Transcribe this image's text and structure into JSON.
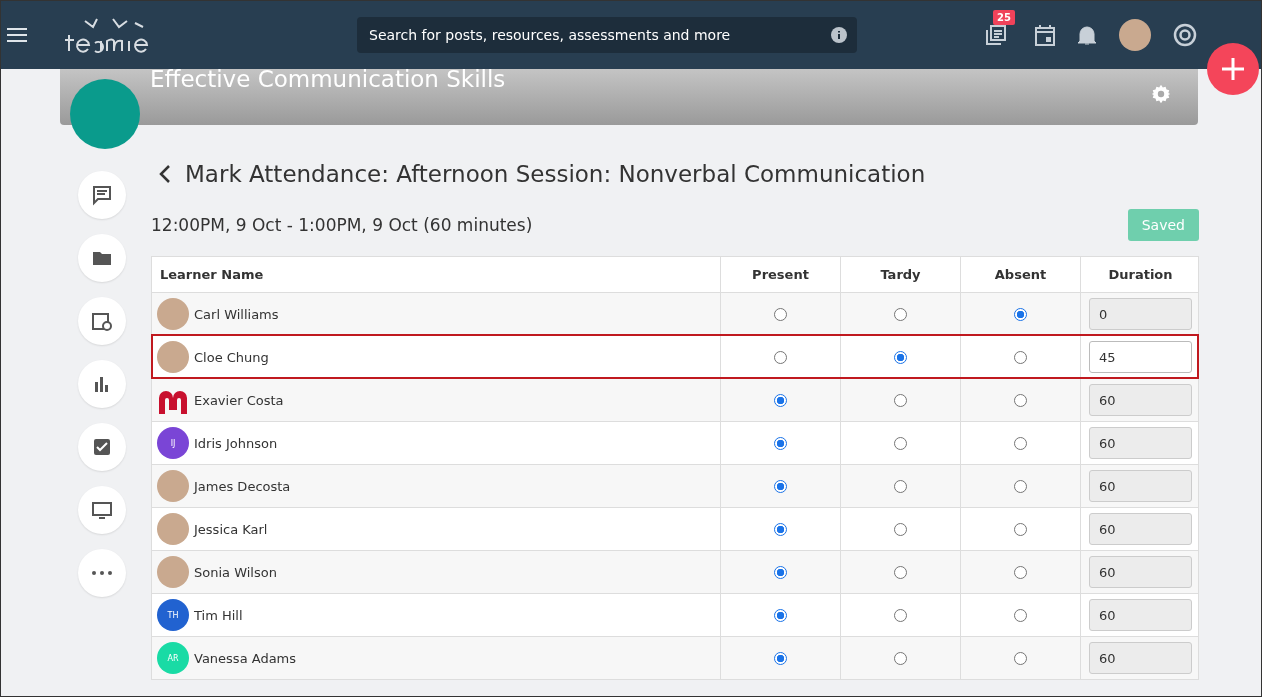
{
  "header": {
    "search": {
      "placeholder": "Search for posts, resources, assessments and more"
    },
    "badge": "25"
  },
  "course": {
    "title": "Effective Communication Skills"
  },
  "sidebar": {
    "items": [
      {
        "kind": "posts"
      },
      {
        "kind": "folder"
      },
      {
        "kind": "schedule"
      },
      {
        "kind": "chart"
      },
      {
        "kind": "check"
      },
      {
        "kind": "screen"
      },
      {
        "kind": "more"
      }
    ]
  },
  "page": {
    "title": "Mark Attendance: Afternoon Session: Nonverbal Communication",
    "time": "12:00PM, 9 Oct - 1:00PM, 9 Oct (60 minutes)",
    "status": "Saved"
  },
  "table": {
    "columns": [
      "Learner Name",
      "Present",
      "Tardy",
      "Absent",
      "Duration"
    ],
    "rows": [
      {
        "name": "Carl Williams",
        "avatar": {
          "kind": "photo"
        },
        "choices": [
          {
            "selected": false
          },
          {
            "selected": false
          },
          {
            "selected": true
          }
        ],
        "duration": {
          "value": "0",
          "disabled": true
        },
        "highlighted": false
      },
      {
        "name": "Cloe Chung",
        "avatar": {
          "kind": "photo"
        },
        "choices": [
          {
            "selected": false
          },
          {
            "selected": true
          },
          {
            "selected": false
          }
        ],
        "duration": {
          "value": "45",
          "disabled": false
        },
        "highlighted": true
      },
      {
        "name": "Exavier Costa",
        "avatar": {
          "kind": "logo"
        },
        "choices": [
          {
            "selected": true
          },
          {
            "selected": false
          },
          {
            "selected": false
          }
        ],
        "duration": {
          "value": "60",
          "disabled": true
        },
        "highlighted": false
      },
      {
        "name": "Idris Johnson",
        "avatar": {
          "kind": "initials",
          "initials": "IJ",
          "color": "#7a45d6"
        },
        "choices": [
          {
            "selected": true
          },
          {
            "selected": false
          },
          {
            "selected": false
          }
        ],
        "duration": {
          "value": "60",
          "disabled": true
        },
        "highlighted": false
      },
      {
        "name": "James Decosta",
        "avatar": {
          "kind": "photo"
        },
        "choices": [
          {
            "selected": true
          },
          {
            "selected": false
          },
          {
            "selected": false
          }
        ],
        "duration": {
          "value": "60",
          "disabled": true
        },
        "highlighted": false
      },
      {
        "name": "Jessica Karl",
        "avatar": {
          "kind": "photo"
        },
        "choices": [
          {
            "selected": true
          },
          {
            "selected": false
          },
          {
            "selected": false
          }
        ],
        "duration": {
          "value": "60",
          "disabled": true
        },
        "highlighted": false
      },
      {
        "name": "Sonia Wilson",
        "avatar": {
          "kind": "photo"
        },
        "choices": [
          {
            "selected": true
          },
          {
            "selected": false
          },
          {
            "selected": false
          }
        ],
        "duration": {
          "value": "60",
          "disabled": true
        },
        "highlighted": false
      },
      {
        "name": "Tim Hill",
        "avatar": {
          "kind": "initials",
          "initials": "TH",
          "color": "#2162d0"
        },
        "choices": [
          {
            "selected": true
          },
          {
            "selected": false
          },
          {
            "selected": false
          }
        ],
        "duration": {
          "value": "60",
          "disabled": true
        },
        "highlighted": false
      },
      {
        "name": "Vanessa Adams",
        "avatar": {
          "kind": "initials",
          "initials": "AR",
          "color": "#19dba5"
        },
        "choices": [
          {
            "selected": true
          },
          {
            "selected": false
          },
          {
            "selected": false
          }
        ],
        "duration": {
          "value": "60",
          "disabled": true
        },
        "highlighted": false
      }
    ]
  }
}
